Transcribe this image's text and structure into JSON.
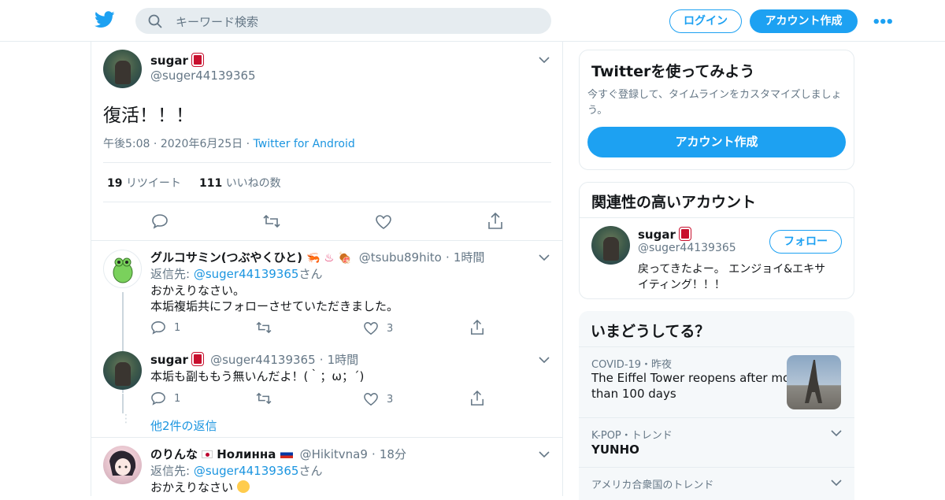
{
  "header": {
    "search_placeholder": "キーワード検索",
    "login_label": "ログイン",
    "signup_label": "アカウント作成",
    "more_label": "•••",
    "accent": "#1da1f2"
  },
  "main_tweet": {
    "name": "sugar",
    "handle": "@suger44139365",
    "text": "復活！！！",
    "time": "午後5:08",
    "date": "2020年6月25日",
    "source": "Twitter for Android",
    "retweet_count": "19",
    "retweet_label": "リツイート",
    "like_count": "111",
    "like_label": "いいねの数"
  },
  "replies": [
    {
      "name": "グルコサミン(つぶやくひと)",
      "handle": "@tsubu89hito",
      "time": "1時間",
      "reply_to_prefix": "返信先:",
      "reply_to_handle": "@suger44139365",
      "reply_to_suffix": "さん",
      "text_line1": "おかえりなさい。",
      "text_line2": "本垢複垢共にフォローさせていただきました。",
      "reply_count": "1",
      "like_count": "3"
    },
    {
      "name": "sugar",
      "handle": "@suger44139365",
      "time": "1時間",
      "text": "本垢も副ももう無いんだよ！(｀；ω；´)",
      "reply_count": "1",
      "like_count": "3",
      "more_replies": "他2件の返信"
    },
    {
      "name": "のりんな",
      "name2": "Нолинна",
      "handle": "@Hikitvna9",
      "time": "18分",
      "reply_to_prefix": "返信先:",
      "reply_to_handle": "@suger44139365",
      "reply_to_suffix": "さん",
      "text": "おかえりなさい"
    }
  ],
  "sidebar": {
    "try_title": "Twitterを使ってみよう",
    "try_desc_line1": "今すぐ登録して、タイムラインをカスタマイズしましょ",
    "try_desc_line2": "う。",
    "try_button": "アカウント作成",
    "related_title": "関連性の高いアカウント",
    "related_name": "sugar",
    "related_handle": "@suger44139365",
    "follow_label": "フォロー",
    "related_bio_line1": "戻ってきたよー。 エンジョイ&エキサ",
    "related_bio_line2": "イティング！！！",
    "trends_title": "いまどうしてる？",
    "trends": [
      {
        "meta": "COVID-19・昨夜",
        "title_line1": "The Eiffel Tower reopens after more",
        "title_line2": "than 100 days"
      },
      {
        "meta": "K-POP・トレンド",
        "title_line1": "YUNHO"
      },
      {
        "meta": "アメリカ合衆国のトレンド",
        "title_line1": ""
      }
    ]
  }
}
